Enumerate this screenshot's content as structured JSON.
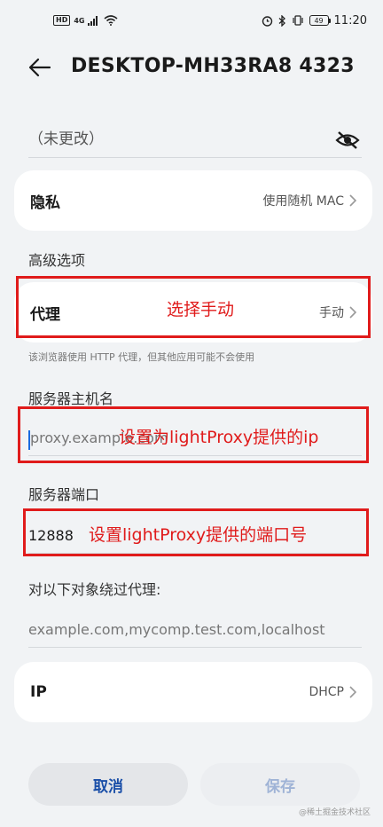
{
  "status_bar": {
    "hd": "HD",
    "net": "4G",
    "battery": "49",
    "time": "11:20"
  },
  "header": {
    "title": "DESKTOP-MH33RA8 4323"
  },
  "password": {
    "value": "（未更改）"
  },
  "privacy": {
    "label": "隐私",
    "value": "使用随机 MAC"
  },
  "advanced": {
    "title": "高级选项"
  },
  "proxy": {
    "label": "代理",
    "value": "手动",
    "hint": "该浏览器使用 HTTP 代理，但其他应用可能不会使用"
  },
  "server_host": {
    "label": "服务器主机名",
    "placeholder": "proxy.example.com"
  },
  "server_port": {
    "label": "服务器端口",
    "value": "12888"
  },
  "bypass": {
    "label": "对以下对象绕过代理:",
    "placeholder": "example.com,mycomp.test.com,localhost"
  },
  "ip": {
    "label": "IP",
    "value": "DHCP"
  },
  "buttons": {
    "cancel": "取消",
    "save": "保存"
  },
  "annotations": {
    "proxy": "选择手动",
    "host": "设置为lightProxy提供的ip",
    "port": "设置lightProxy提供的端口号"
  },
  "watermark": "@稀土掘金技术社区",
  "colors": {
    "accent": "#1a4fa8",
    "save_disabled": "#9fb3d6",
    "annotation": "#e01b1b"
  }
}
